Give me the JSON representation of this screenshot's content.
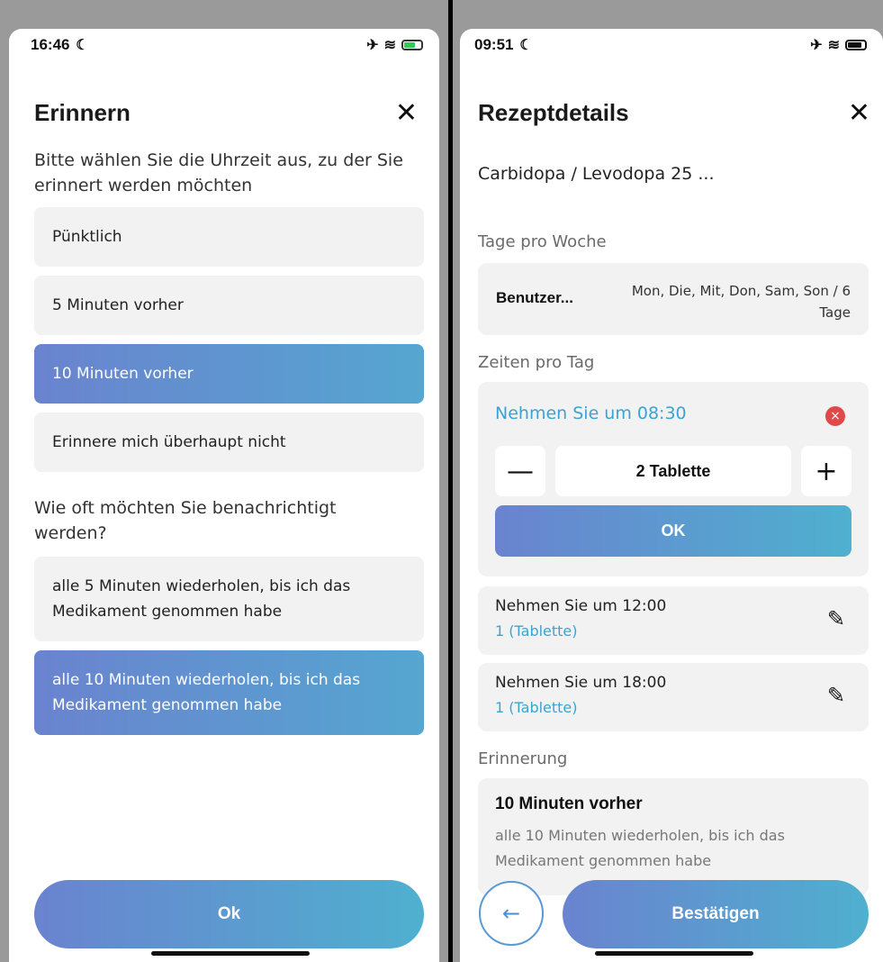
{
  "left": {
    "status": {
      "time": "16:46",
      "moon": "☾",
      "airplane": "✈",
      "wifi": "≋"
    },
    "title": "Erinnern",
    "close_icon": "✕",
    "prompt_time": "Bitte wählen Sie die Uhrzeit aus, zu der Sie erinnert werden möchten",
    "time_options": [
      "Pünktlich",
      "5 Minuten vorher",
      "10 Minuten vorher",
      "Erinnere mich überhaupt nicht"
    ],
    "selected_time_index": 2,
    "prompt_frequency": "Wie oft möchten Sie benachrichtigt werden?",
    "frequency_options": [
      "alle 5 Minuten wiederholen, bis ich das Medikament genommen habe",
      "alle 10 Minuten wiederholen, bis ich das Medikament genommen habe"
    ],
    "selected_frequency_index": 1,
    "ok_button": "Ok"
  },
  "right": {
    "status": {
      "time": "09:51",
      "moon": "☾",
      "airplane": "✈",
      "wifi": "≋"
    },
    "title": "Rezeptdetails",
    "close_icon": "✕",
    "drug_name": "Carbidopa / Levodopa 25 ...",
    "days_label": "Tage pro Woche",
    "days_mode": "Benutzer...",
    "days_value": "Mon, Die, Mit, Don, Sam, Son / 6 Tage",
    "times_label": "Zeiten pro Tag",
    "editing": {
      "take_at": "Nehmen Sie um 08:30",
      "delete_icon": "×",
      "minus": "—",
      "plus": "+",
      "amount": "2 Tablette",
      "ok": "OK"
    },
    "times": [
      {
        "take_at": "Nehmen Sie um 12:00",
        "amount": "1 (Tablette)"
      },
      {
        "take_at": "Nehmen Sie um 18:00",
        "amount": "1 (Tablette)"
      }
    ],
    "edit_icon": "✎",
    "reminder_label": "Erinnerung",
    "reminder_title": "10 Minuten vorher",
    "reminder_desc": "alle 10 Minuten wiederholen, bis ich das Medikament genommen habe",
    "back_icon": "←",
    "confirm_button": "Bestätigen"
  },
  "colors": {
    "accent_start": "#6a83cf",
    "accent_end": "#4fb0cf",
    "link_blue": "#3aa3d3",
    "delete_red": "#e04949",
    "card_bg": "#f2f2f2"
  }
}
